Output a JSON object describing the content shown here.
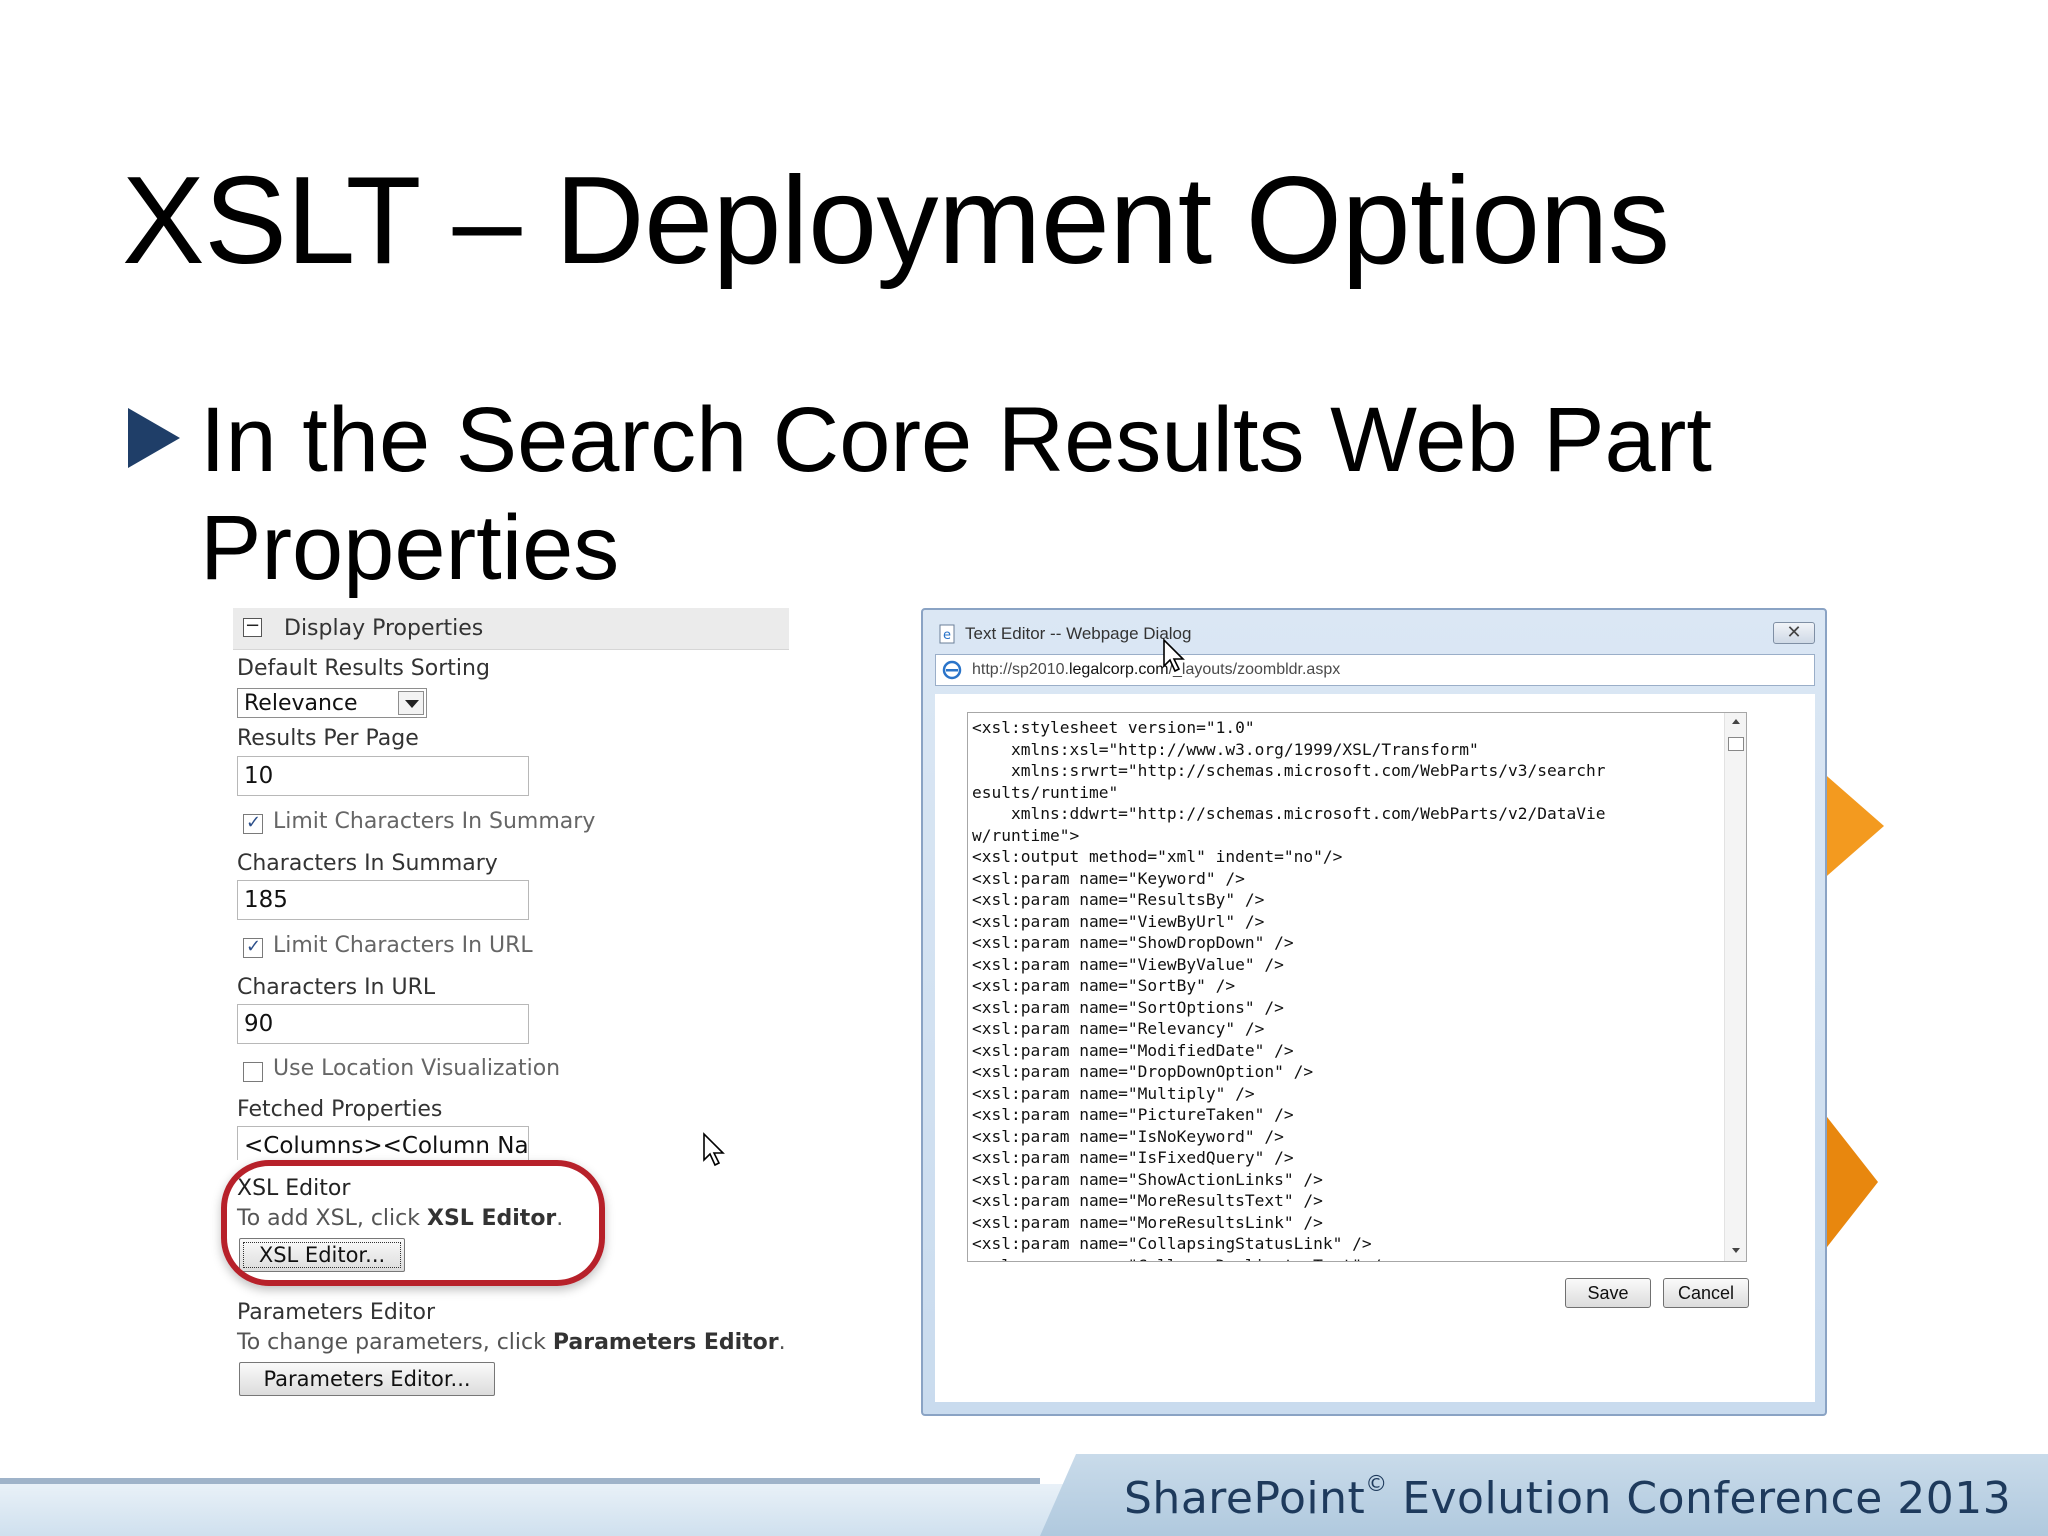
{
  "slide": {
    "title": "XSLT – Deployment Options",
    "bullet": "In the Search Core Results Web Part Properties"
  },
  "props": {
    "header": "Display Properties",
    "default_sorting_label": "Default Results Sorting",
    "default_sorting_value": "Relevance",
    "results_per_page_label": "Results Per Page",
    "results_per_page_value": "10",
    "limit_summary_label": "Limit Characters In Summary",
    "limit_summary_checked": true,
    "chars_summary_label": "Characters In Summary",
    "chars_summary_value": "185",
    "limit_url_label": "Limit Characters In URL",
    "limit_url_checked": true,
    "chars_url_label": "Characters In URL",
    "chars_url_value": "90",
    "location_viz_label": "Use Location Visualization",
    "location_viz_checked": false,
    "fetched_label": "Fetched Properties",
    "fetched_value": "<Columns><Column Nam",
    "xsl_editor_label": "XSL Editor",
    "xsl_hint_prefix": "To add XSL, click ",
    "xsl_hint_bold": "XSL Editor",
    "xsl_hint_suffix": ".",
    "xsl_button": "XSL Editor...",
    "params_label": "Parameters Editor",
    "params_hint_prefix": "To change parameters, click ",
    "params_hint_bold": "Parameters Editor",
    "params_hint_suffix": ".",
    "params_button": "Parameters Editor..."
  },
  "dialog": {
    "title": "Text Editor -- Webpage Dialog",
    "url_prefix": "http://sp2010.",
    "url_domain": "legalcorp.com",
    "url_suffix": "/_layouts/zoombldr.aspx",
    "code": "<xsl:stylesheet version=\"1.0\"\n    xmlns:xsl=\"http://www.w3.org/1999/XSL/Transform\"\n    xmlns:srwrt=\"http://schemas.microsoft.com/WebParts/v3/searchr\nesults/runtime\"\n    xmlns:ddwrt=\"http://schemas.microsoft.com/WebParts/v2/DataVie\nw/runtime\">\n<xsl:output method=\"xml\" indent=\"no\"/>\n<xsl:param name=\"Keyword\" />\n<xsl:param name=\"ResultsBy\" />\n<xsl:param name=\"ViewByUrl\" />\n<xsl:param name=\"ShowDropDown\" />\n<xsl:param name=\"ViewByValue\" />\n<xsl:param name=\"SortBy\" />\n<xsl:param name=\"SortOptions\" />\n<xsl:param name=\"Relevancy\" />\n<xsl:param name=\"ModifiedDate\" />\n<xsl:param name=\"DropDownOption\" />\n<xsl:param name=\"Multiply\" />\n<xsl:param name=\"PictureTaken\" />\n<xsl:param name=\"IsNoKeyword\" />\n<xsl:param name=\"IsFixedQuery\" />\n<xsl:param name=\"ShowActionLinks\" />\n<xsl:param name=\"MoreResultsText\" />\n<xsl:param name=\"MoreResultsLink\" />\n<xsl:param name=\"CollapsingStatusLink\" />\n<xsl:param name=\"CollapseDuplicatesText\" />",
    "save_label": "Save",
    "cancel_label": "Cancel",
    "close_glyph": "✕"
  },
  "footer": {
    "brand": "SharePoint",
    "reg": "©",
    "rest": " Evolution Conference 2013"
  },
  "colors": {
    "highlight": "#b7212a",
    "bullet": "#1f3e68",
    "accent_orange": "#f39a1f",
    "footer_text": "#1e3a5c"
  },
  "icons": [
    "bullet-triangle-icon",
    "collapse-minus-icon",
    "dropdown-arrow-icon",
    "ie-page-icon",
    "close-icon",
    "mouse-cursor-icon"
  ]
}
